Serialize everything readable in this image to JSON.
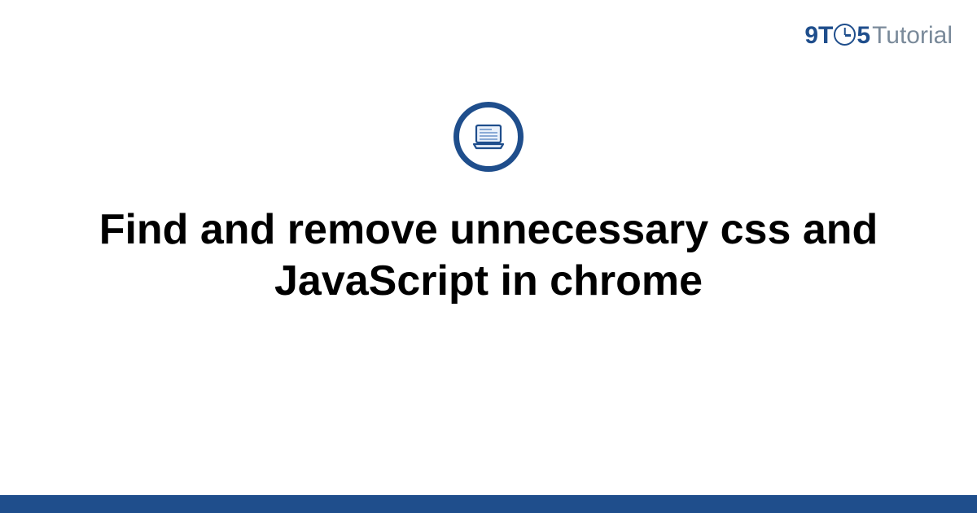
{
  "brand": {
    "part1": "9T",
    "part2": "5",
    "part3": "Tutorial"
  },
  "title": "Find and remove unnecessary css and JavaScript in chrome",
  "colors": {
    "primary": "#1f4e8c",
    "muted": "#7a8a9a"
  }
}
